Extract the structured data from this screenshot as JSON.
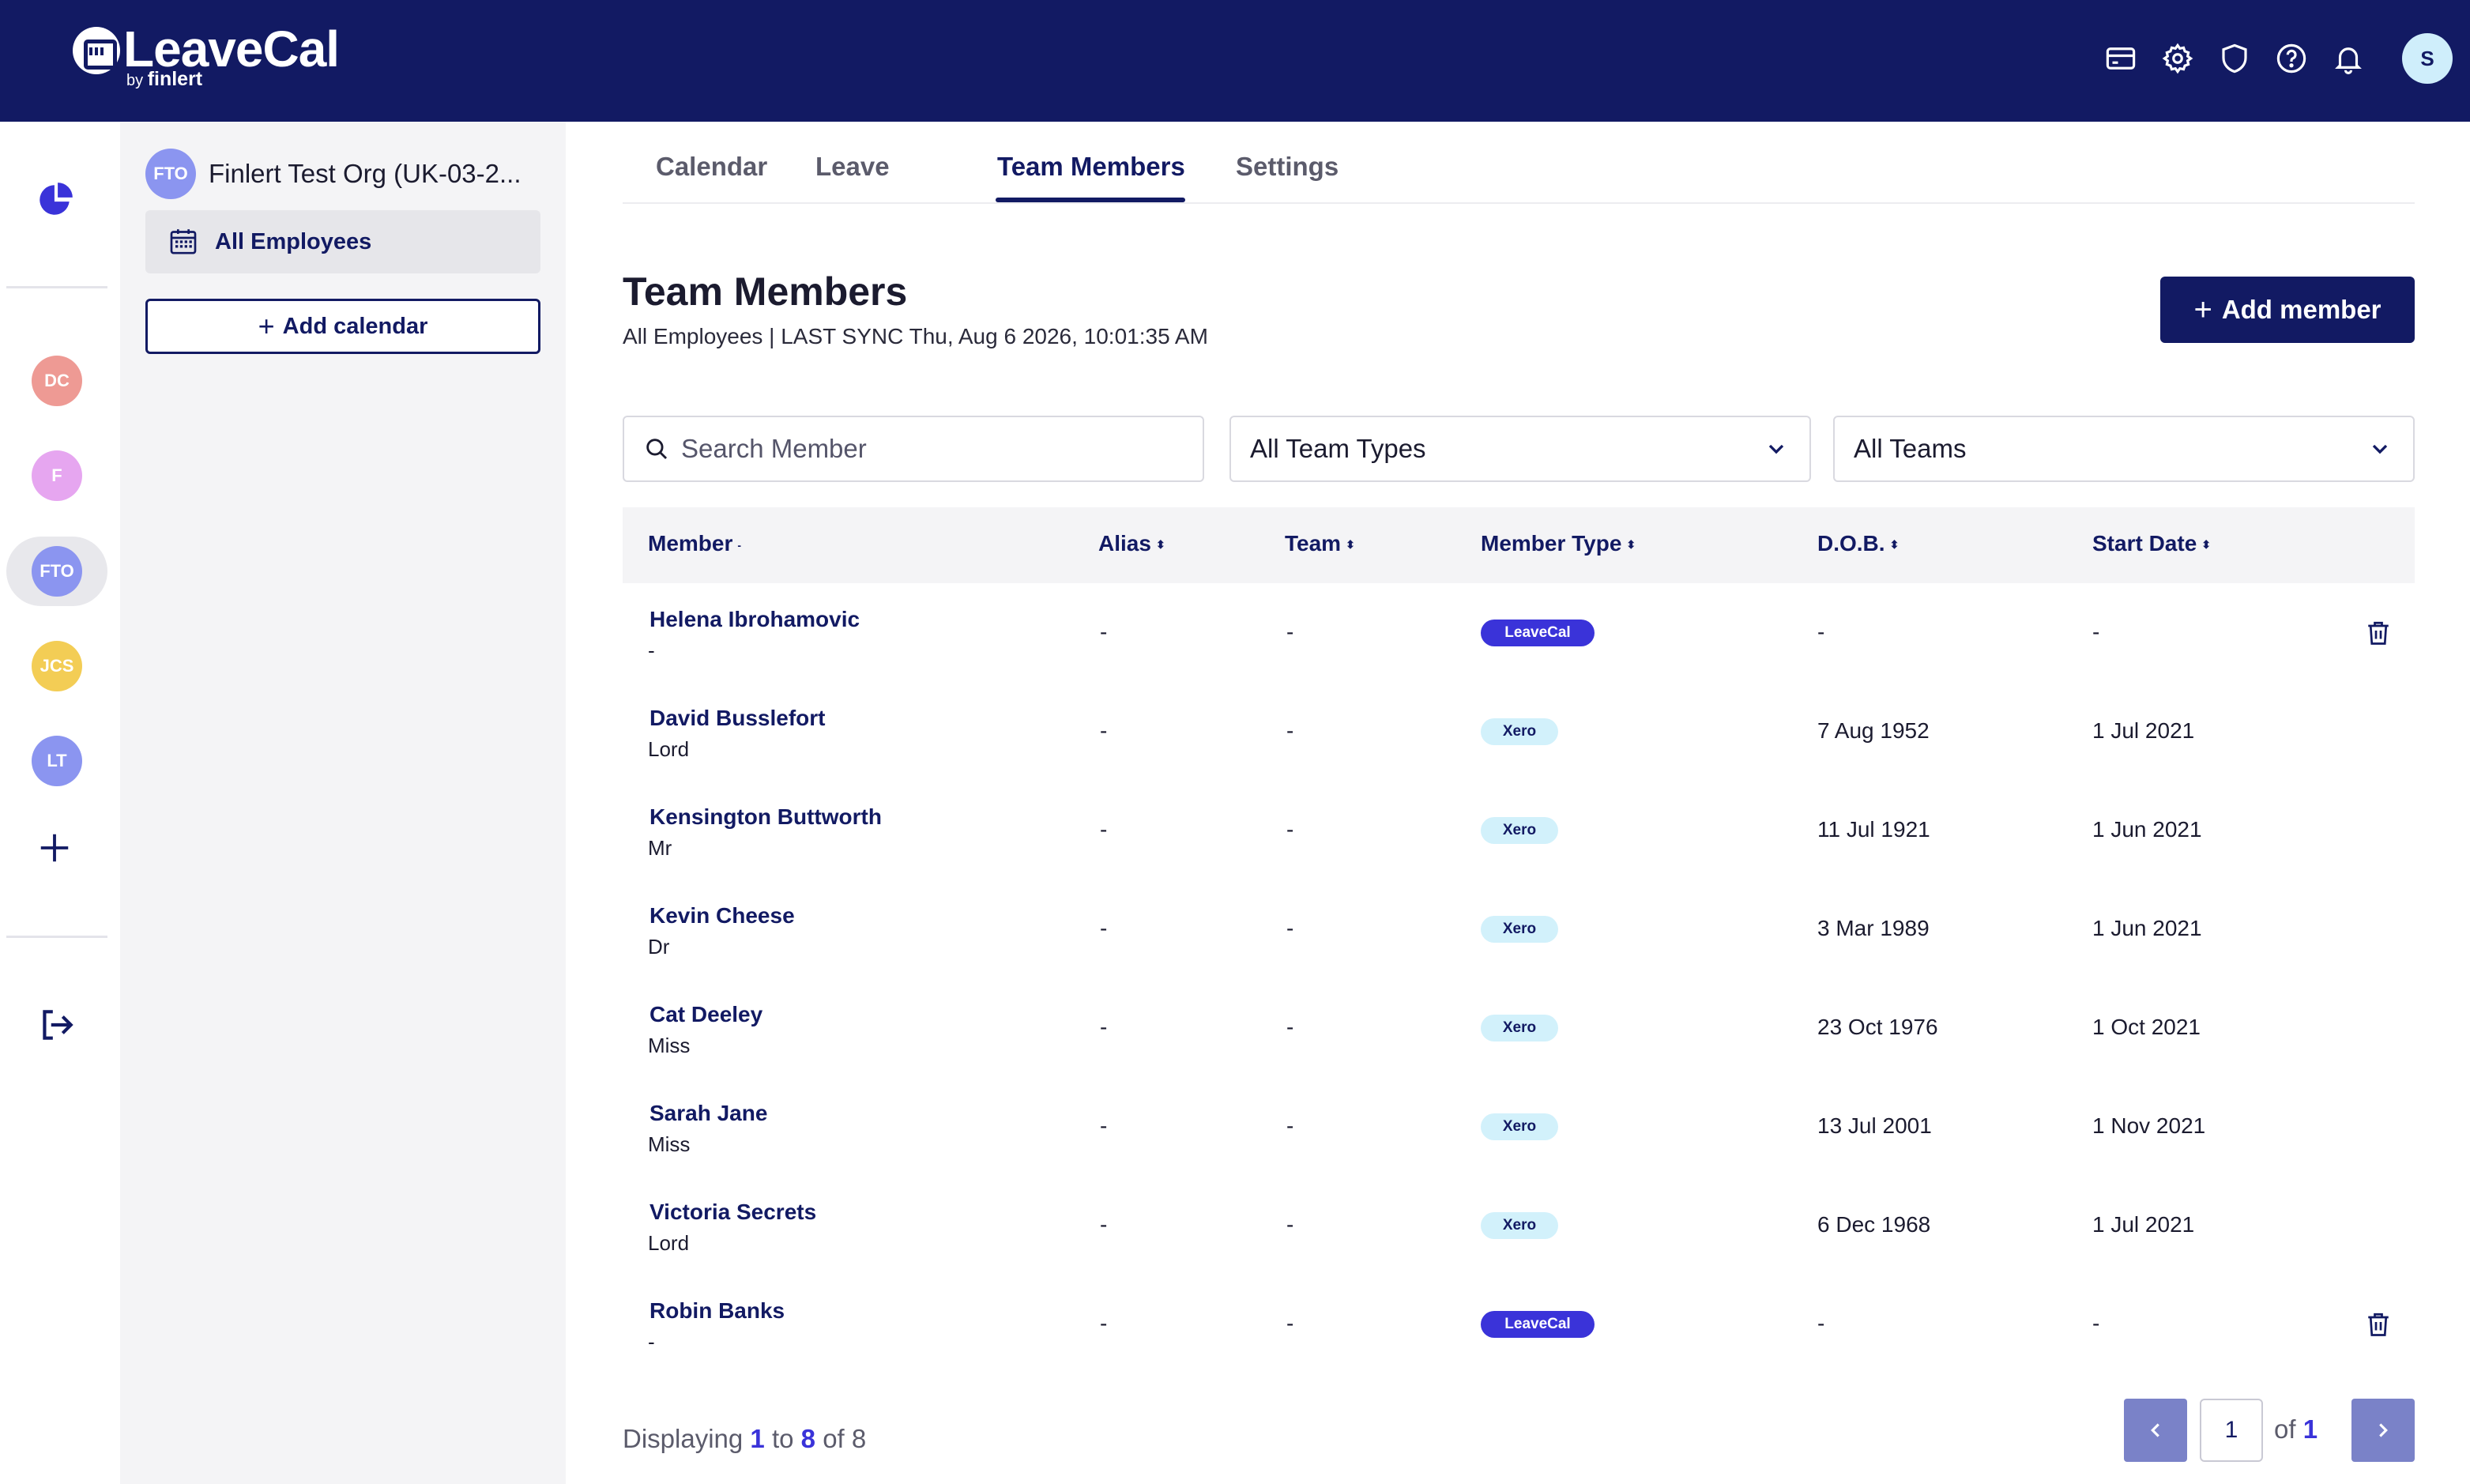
{
  "app": {
    "brand": "LeaveCal",
    "brand_by": "by",
    "brand_company": "finlert"
  },
  "topbar": {
    "icons": [
      "billing-card-icon",
      "settings-gear-icon",
      "shield-icon",
      "help-icon",
      "bell-icon"
    ],
    "user_initial": "S"
  },
  "rail": {
    "orgs": [
      {
        "initials": "DC",
        "color": "#ee9a94"
      },
      {
        "initials": "F",
        "color": "#e6a6f0"
      },
      {
        "initials": "FTO",
        "color": "#8b95f0",
        "active": true
      },
      {
        "initials": "JCS",
        "color": "#f3cd55"
      },
      {
        "initials": "LT",
        "color": "#8b95f0"
      }
    ]
  },
  "calendars": {
    "org_initials": "FTO",
    "org_name": "Finlert Test Org (UK-03-2...",
    "items": [
      {
        "label": "All Employees"
      }
    ],
    "add_label": "Add calendar"
  },
  "tabs": [
    {
      "label": "Calendar",
      "active": false
    },
    {
      "label": "Leave",
      "active": false
    },
    {
      "label": "Team Members",
      "active": true
    },
    {
      "label": "Settings",
      "active": false
    }
  ],
  "page": {
    "title": "Team Members",
    "subtitle": "All Employees | LAST SYNC Thu, Aug 6 2026, 10:01:35 AM",
    "add_button": "Add member"
  },
  "filters": {
    "search_placeholder": "Search Member",
    "team_types": "All Team Types",
    "teams": "All Teams"
  },
  "table": {
    "columns": [
      "Member",
      "Alias",
      "Team",
      "Member Type",
      "D.O.B.",
      "Start Date"
    ],
    "rows": [
      {
        "name": "Helena Ibrohamovic",
        "title": "-",
        "alias": "-",
        "team": "-",
        "type": "LeaveCal",
        "dob": "-",
        "start": "-",
        "deletable": true
      },
      {
        "name": "David Busslefort",
        "title": "Lord",
        "alias": "-",
        "team": "-",
        "type": "Xero",
        "dob": "7 Aug 1952",
        "start": "1 Jul 2021",
        "deletable": false
      },
      {
        "name": "Kensington Buttworth",
        "title": "Mr",
        "alias": "-",
        "team": "-",
        "type": "Xero",
        "dob": "11 Jul 1921",
        "start": "1 Jun 2021",
        "deletable": false
      },
      {
        "name": "Kevin Cheese",
        "title": "Dr",
        "alias": "-",
        "team": "-",
        "type": "Xero",
        "dob": "3 Mar 1989",
        "start": "1 Jun 2021",
        "deletable": false
      },
      {
        "name": "Cat Deeley",
        "title": "Miss",
        "alias": "-",
        "team": "-",
        "type": "Xero",
        "dob": "23 Oct 1976",
        "start": "1 Oct 2021",
        "deletable": false
      },
      {
        "name": "Sarah Jane",
        "title": "Miss",
        "alias": "-",
        "team": "-",
        "type": "Xero",
        "dob": "13 Jul 2001",
        "start": "1 Nov 2021",
        "deletable": false
      },
      {
        "name": "Victoria Secrets",
        "title": "Lord",
        "alias": "-",
        "team": "-",
        "type": "Xero",
        "dob": "6 Dec 1968",
        "start": "1 Jul 2021",
        "deletable": false
      },
      {
        "name": "Robin Banks",
        "title": "-",
        "alias": "-",
        "team": "-",
        "type": "LeaveCal",
        "dob": "-",
        "start": "-",
        "deletable": true
      }
    ]
  },
  "footer": {
    "displaying_label": "Displaying",
    "from": "1",
    "to_label": "to",
    "to": "8",
    "of_label": "of 8",
    "page_value": "1",
    "page_of_label": "of",
    "page_total": "1"
  },
  "colors": {
    "navy": "#121a63",
    "accent": "#3a33d9",
    "xero_badge": "#d2f1fb"
  }
}
